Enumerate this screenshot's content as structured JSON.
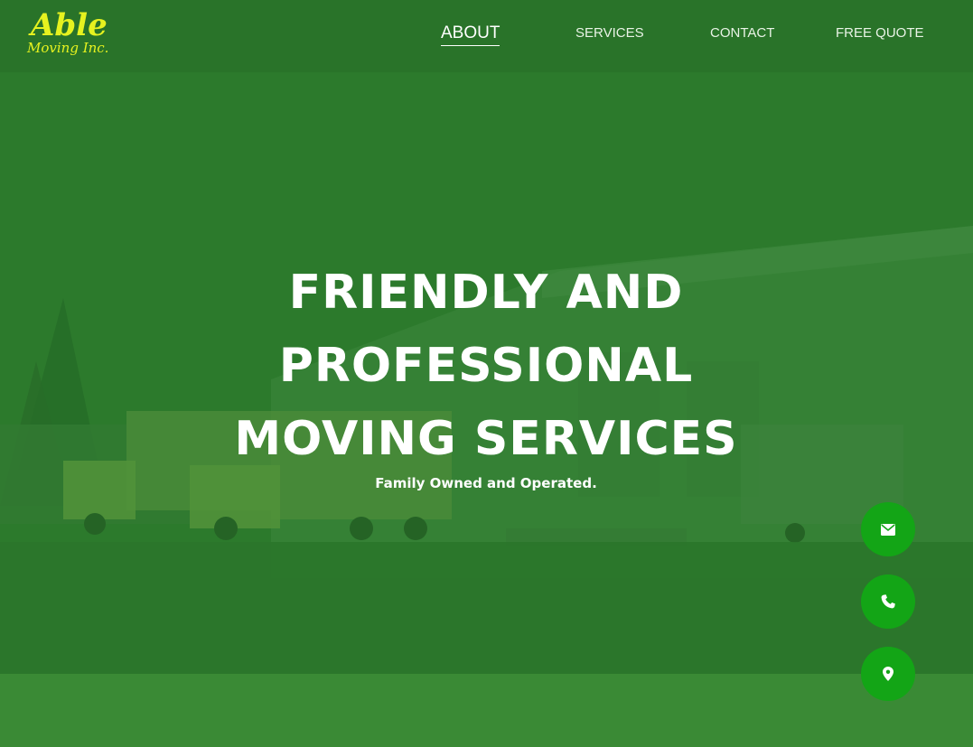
{
  "logo": {
    "main": "Able",
    "sub": "Moving Inc."
  },
  "nav": {
    "items": [
      {
        "label": "ABOUT",
        "active": true
      },
      {
        "label": "SERVICES",
        "active": false
      },
      {
        "label": "CONTACT",
        "active": false
      },
      {
        "label": "FREE QUOTE",
        "active": false
      }
    ]
  },
  "hero": {
    "headline_lines": [
      "FRIENDLY AND",
      "PROFESSIONAL",
      "MOVING SERVICES"
    ],
    "tagline": "Family Owned and Operated."
  },
  "actions": [
    {
      "icon": "envelope-icon"
    },
    {
      "icon": "phone-icon"
    },
    {
      "icon": "map-marker-icon"
    }
  ],
  "colors": {
    "overlay_green": "#2c782c",
    "logo_yellow": "#e6f21f",
    "fab_green": "#13a516",
    "text_white": "#ffffff"
  }
}
